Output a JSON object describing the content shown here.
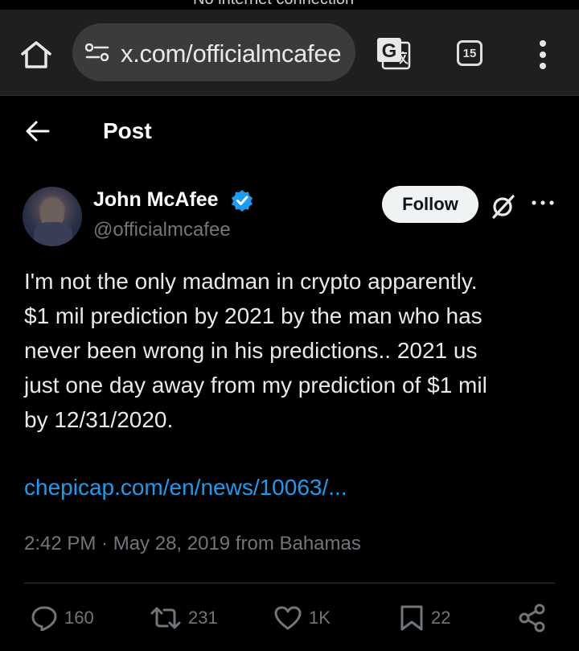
{
  "status_bar": {
    "text": "No internet connection"
  },
  "browser": {
    "url": "x.com/officialmcafee",
    "tab_count": "15"
  },
  "header": {
    "title": "Post"
  },
  "author": {
    "name": "John McAfee",
    "handle": "@officialmcafee",
    "verified": true
  },
  "follow_label": "Follow",
  "tweet": {
    "text": "I'm not the only madman in crypto apparently.\n$1 mil prediction by 2021 by the man who has\nnever been wrong in his predictions.. 2021 us\njust one day away from my prediction  of $1 mil\nby 12/31/2020.",
    "link": "chepicap.com/en/news/10063/...",
    "timestamp": "2:42 PM · May 28, 2019 from Bahamas"
  },
  "actions": {
    "replies": "160",
    "reposts": "231",
    "likes": "1K",
    "bookmarks": "22"
  },
  "colors": {
    "background": "#000000",
    "toolbar": "#1f1f1f",
    "link": "#1d9bf0",
    "secondary_text": "#71767b",
    "verified": "#1d9bf0"
  }
}
